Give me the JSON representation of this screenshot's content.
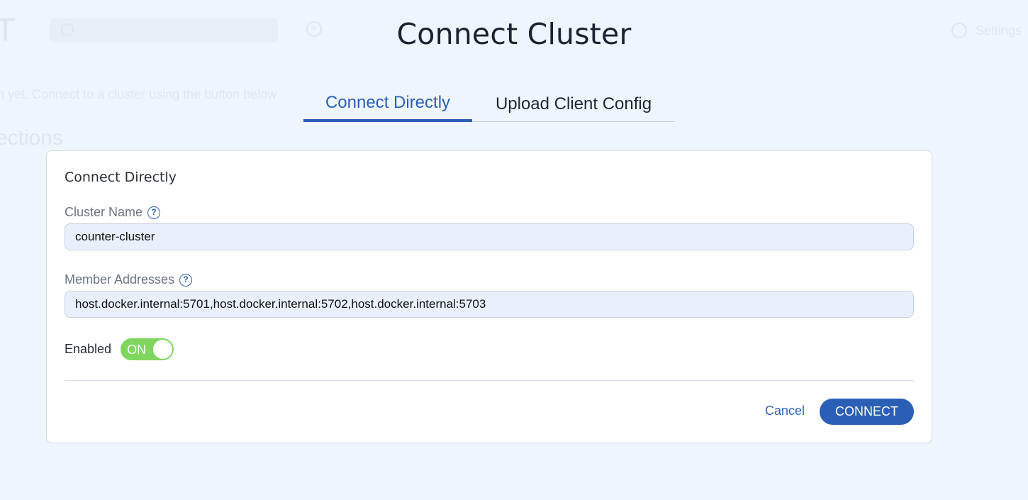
{
  "background": {
    "logo": "T",
    "settings_label": "Settings",
    "message": "n yet. Connect to a cluster using the button below",
    "section_heading": "ections"
  },
  "modal": {
    "title": "Connect Cluster",
    "tabs": [
      {
        "label": "Connect Directly",
        "active": true
      },
      {
        "label": "Upload Client Config",
        "active": false
      }
    ],
    "card_title": "Connect Directly",
    "fields": {
      "cluster_name": {
        "label": "Cluster Name",
        "value": "counter-cluster"
      },
      "member_addresses": {
        "label": "Member Addresses",
        "value": "host.docker.internal:5701,host.docker.internal:5702,host.docker.internal:5703"
      }
    },
    "enabled": {
      "label": "Enabled",
      "state_text": "ON"
    },
    "actions": {
      "cancel": "Cancel",
      "connect": "CONNECT"
    }
  },
  "colors": {
    "accent": "#2a5fb5",
    "toggle_on": "#7fd65f",
    "page_bg": "#eff5fd",
    "input_bg": "#e9f0fb"
  }
}
